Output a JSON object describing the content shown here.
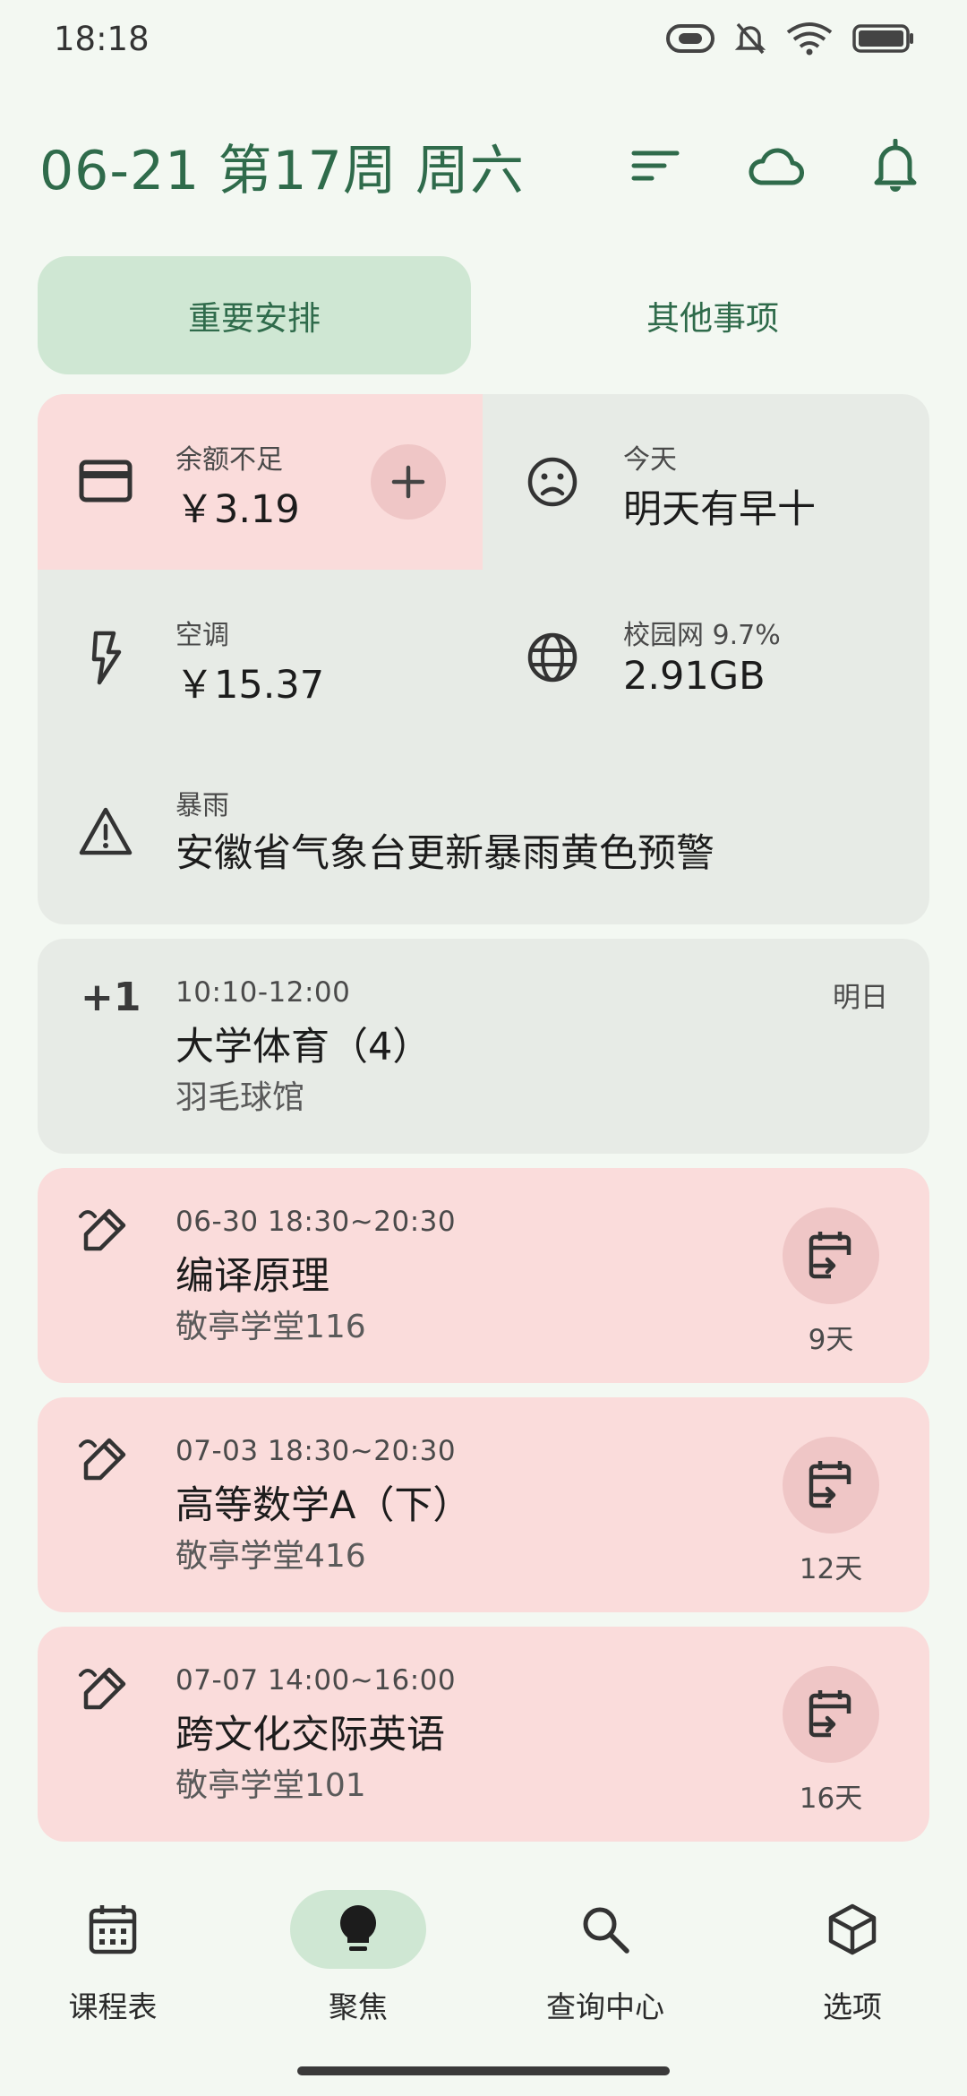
{
  "status_bar": {
    "time": "18:18"
  },
  "header": {
    "title": "06-21 第17周 周六"
  },
  "tabs": [
    {
      "label": "重要安排"
    },
    {
      "label": "其他事项"
    }
  ],
  "info_card": {
    "balance": {
      "label": "余额不足",
      "value": "￥3.19"
    },
    "today": {
      "label": "今天",
      "value": "明天有早十"
    },
    "aircon": {
      "label": "空调",
      "value": "￥15.37"
    },
    "network": {
      "label": "校园网 9.7%",
      "value": "2.91GB"
    },
    "weather": {
      "label": "暴雨",
      "value": "安徽省气象台更新暴雨黄色预警"
    }
  },
  "course": {
    "badge": "+1",
    "time": "10:10-12:00",
    "title": "大学体育（4）",
    "place": "羽毛球馆",
    "day": "明日"
  },
  "exams": [
    {
      "time": "06-30 18:30~20:30",
      "title": "编译原理",
      "place": "敬亭学堂116",
      "countdown": "9天"
    },
    {
      "time": "07-03 18:30~20:30",
      "title": "高等数学A（下）",
      "place": "敬亭学堂416",
      "countdown": "12天"
    },
    {
      "time": "07-07 14:00~16:00",
      "title": "跨文化交际英语",
      "place": "敬亭学堂101",
      "countdown": "16天"
    }
  ],
  "bottom_nav": [
    {
      "label": "课程表",
      "icon": "calendar-icon"
    },
    {
      "label": "聚焦",
      "icon": "lightbulb-icon"
    },
    {
      "label": "查询中心",
      "icon": "search-icon"
    },
    {
      "label": "选项",
      "icon": "cube-icon"
    }
  ],
  "colors": {
    "accent": "#2f6b4b",
    "tab_active": "#cfe7d3",
    "card_gray": "#e7ebe6",
    "card_pink": "#fadcdb",
    "circle_pink": "#efc6c6",
    "background": "#f3f8f2"
  }
}
